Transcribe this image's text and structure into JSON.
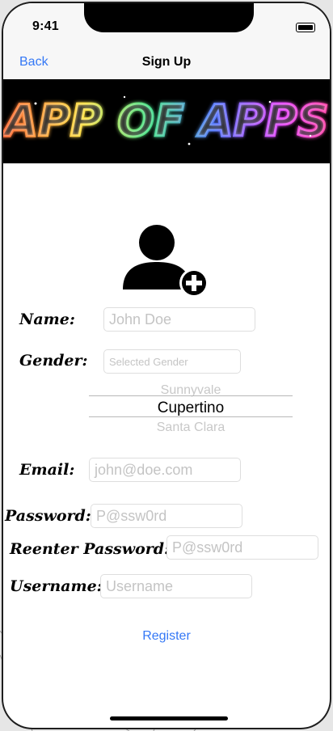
{
  "status": {
    "time": "9:41"
  },
  "nav": {
    "back_label": "Back",
    "title": "Sign Up"
  },
  "banner": {
    "text": "APP OF APPS"
  },
  "form": {
    "name_label": "Name:",
    "name_placeholder": "John Doe",
    "gender_label": "Gender:",
    "gender_placeholder": "Selected Gender",
    "picker": {
      "above": "Sunnyvale",
      "selected": "Cupertino",
      "below": "Santa Clara"
    },
    "email_label": "Email:",
    "email_placeholder": "john@doe.com",
    "password_label": "Password:",
    "password_placeholder": "P@ssw0rd",
    "reenter_label": "Reenter Password:",
    "reenter_placeholder": "P@ssw0rd",
    "username_label": "Username:",
    "username_placeholder": "Username"
  },
  "register_label": "Register",
  "icons": {
    "avatar": "add-user-icon",
    "battery": "battery-icon"
  },
  "colors": {
    "accent": "#3478f6",
    "placeholder": "#c4c4c4"
  }
}
